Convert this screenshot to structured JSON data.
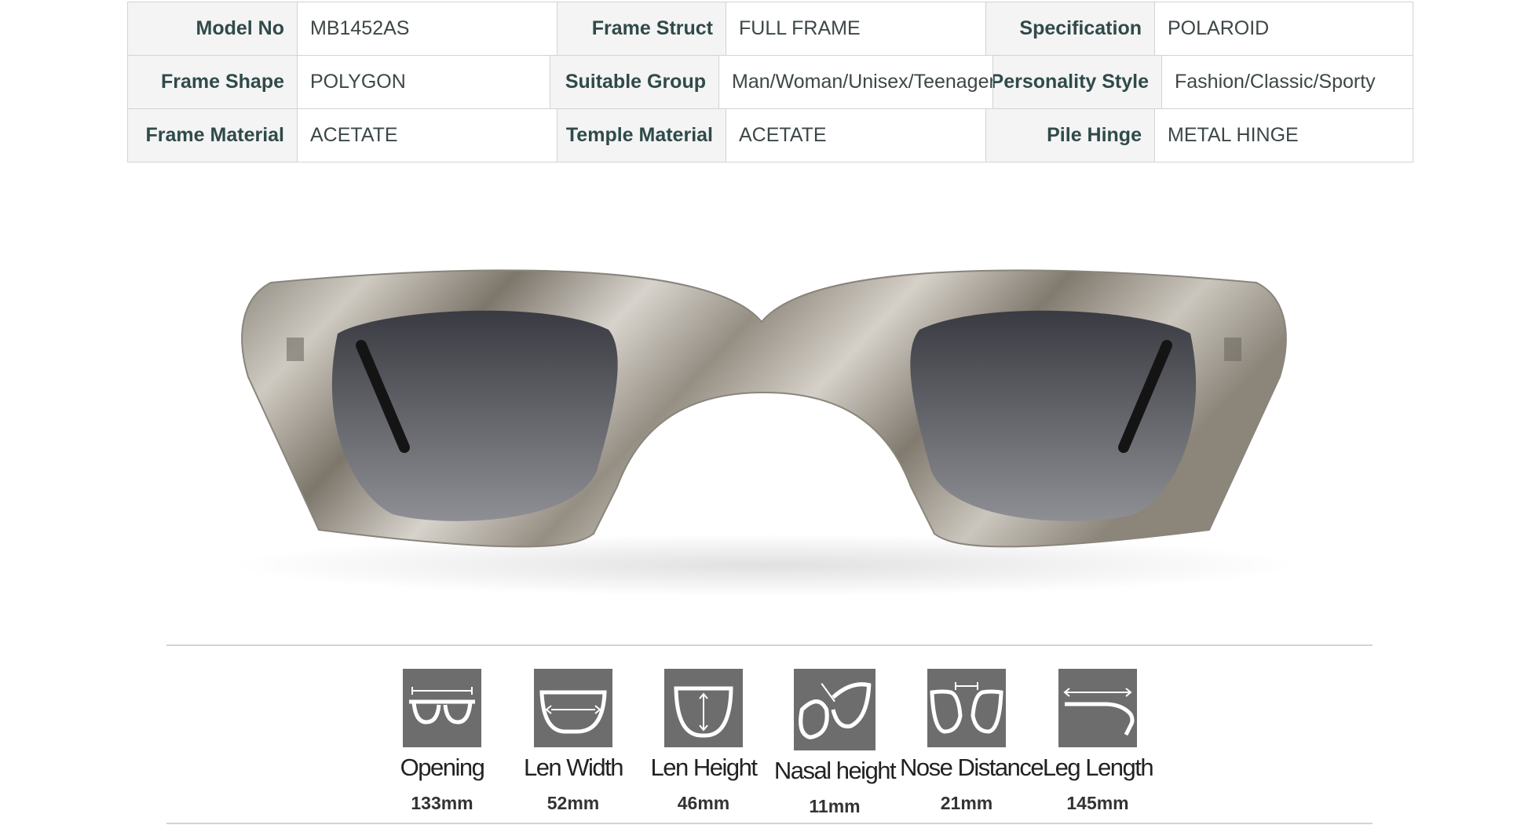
{
  "specs": [
    [
      {
        "label": "Model No",
        "value": "MB1452AS"
      },
      {
        "label": "Frame Struct",
        "value": "FULL FRAME"
      },
      {
        "label": "Specification",
        "value": "POLAROID"
      }
    ],
    [
      {
        "label": "Frame Shape",
        "value": "POLYGON"
      },
      {
        "label": "Suitable Group",
        "value": "Man/Woman/Unisex/Teenager"
      },
      {
        "label": "Personality Style",
        "value": "Fashion/Classic/Sporty"
      }
    ],
    [
      {
        "label": "Frame Material",
        "value": "ACETATE"
      },
      {
        "label": "Temple Material",
        "value": "ACETATE"
      },
      {
        "label": "Pile Hinge",
        "value": "METAL HINGE"
      }
    ]
  ],
  "product": {
    "icon": "sunglasses-image",
    "frame_color": "#b9b4aa",
    "lens_color": "#3c3d43"
  },
  "dimensions": [
    {
      "name": "Opening",
      "value": "133mm",
      "icon": "opening-icon"
    },
    {
      "name": "Len Width",
      "value": "52mm",
      "icon": "lens-width-icon"
    },
    {
      "name": "Len Height",
      "value": "46mm",
      "icon": "lens-height-icon"
    },
    {
      "name": "Nasal height",
      "value": "11mm",
      "icon": "nasal-height-icon"
    },
    {
      "name": "Nose Distance",
      "value": "21mm",
      "icon": "nose-distance-icon"
    },
    {
      "name": "Leg Length",
      "value": "145mm",
      "icon": "leg-length-icon"
    }
  ]
}
